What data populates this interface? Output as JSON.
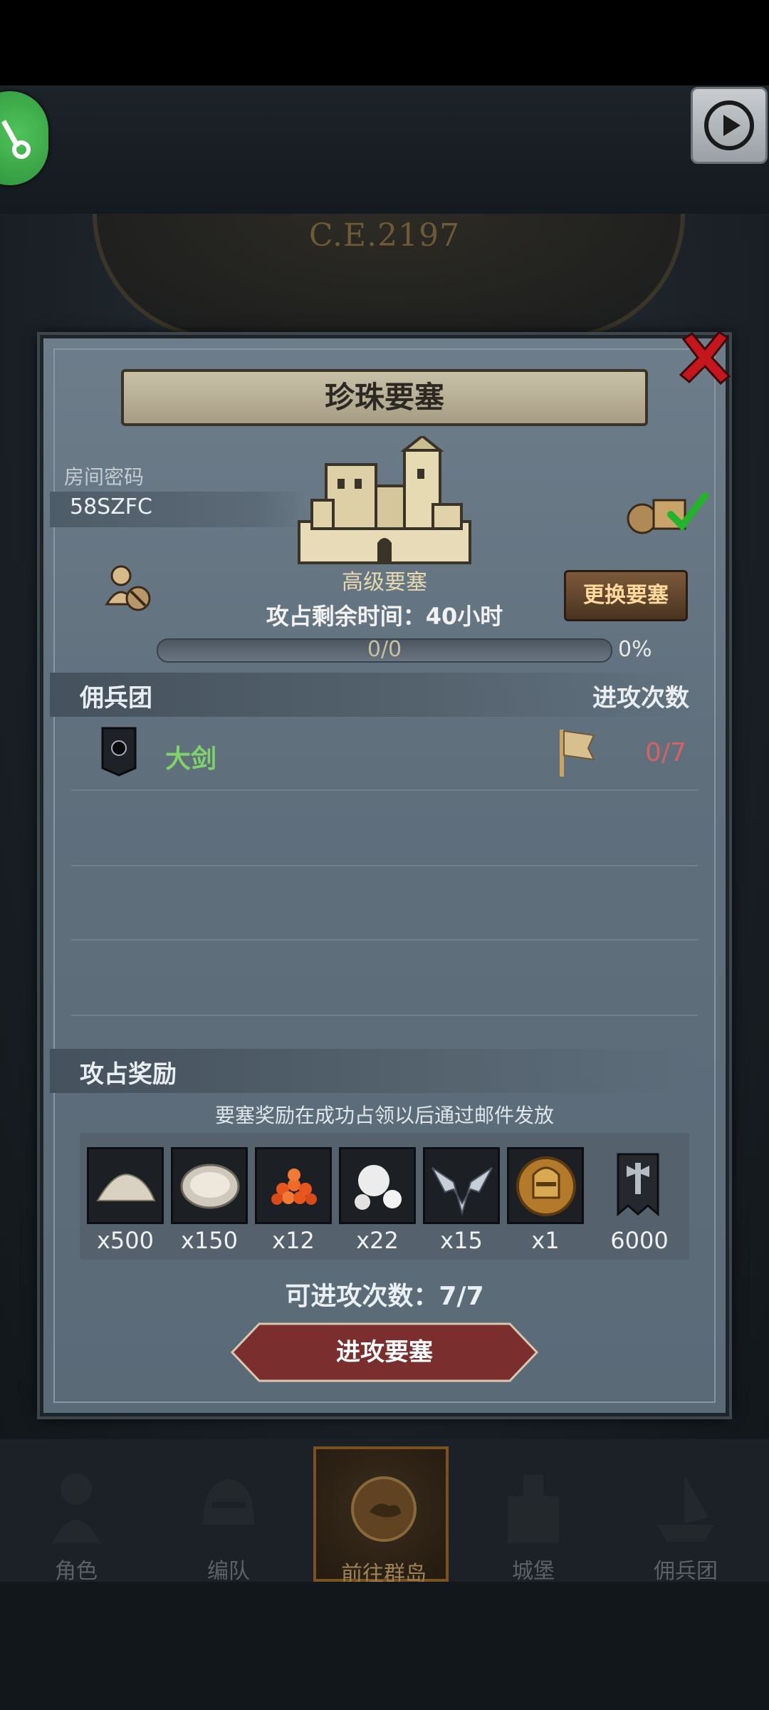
{
  "header": {
    "era_label": "C.E.2197"
  },
  "dialog": {
    "title": "珍珠要塞",
    "room_code_label": "房间密码",
    "room_code": "58SZFC",
    "fortress_grade": "高级要塞",
    "change_button_label": "更换要塞",
    "time_remaining": "攻占剩余时间：40小时",
    "progress_value": "0/0",
    "progress_percent": "0%",
    "progress_fraction": 0,
    "mercenary_section": {
      "left_header": "佣兵团",
      "right_header": "进攻次数",
      "rows": [
        {
          "name": "大剑",
          "attacks": "0/7"
        }
      ]
    },
    "reward_section": {
      "header": "攻占奖励",
      "note": "要塞奖励在成功占领以后通过邮件发放",
      "items": [
        {
          "icon": "sand-pile-icon",
          "qty": "x500"
        },
        {
          "icon": "oyster-icon",
          "qty": "x150"
        },
        {
          "icon": "fish-roe-icon",
          "qty": "x12"
        },
        {
          "icon": "pearl-icon",
          "qty": "x22"
        },
        {
          "icon": "winged-emblem-icon",
          "qty": "x15"
        },
        {
          "icon": "knight-helmet-coin-icon",
          "qty": "x1"
        },
        {
          "icon": "banner-axe-icon",
          "qty": "6000"
        }
      ]
    },
    "attempts_text": "可进攻次数：7/7",
    "attack_button_label": "进攻要塞"
  },
  "bottom_nav": {
    "items": [
      {
        "label": "角色",
        "active": false
      },
      {
        "label": "编队",
        "active": false
      },
      {
        "label": "前往群岛",
        "active": true
      },
      {
        "label": "城堡",
        "active": false
      },
      {
        "label": "佣兵团",
        "active": false
      }
    ]
  },
  "colors": {
    "panel": "#5f6f7c",
    "merc_name": "#7fd36a",
    "attack_count": "#d46464",
    "attack_button": "#7a2e2e",
    "nav_active": "#7a5220"
  }
}
